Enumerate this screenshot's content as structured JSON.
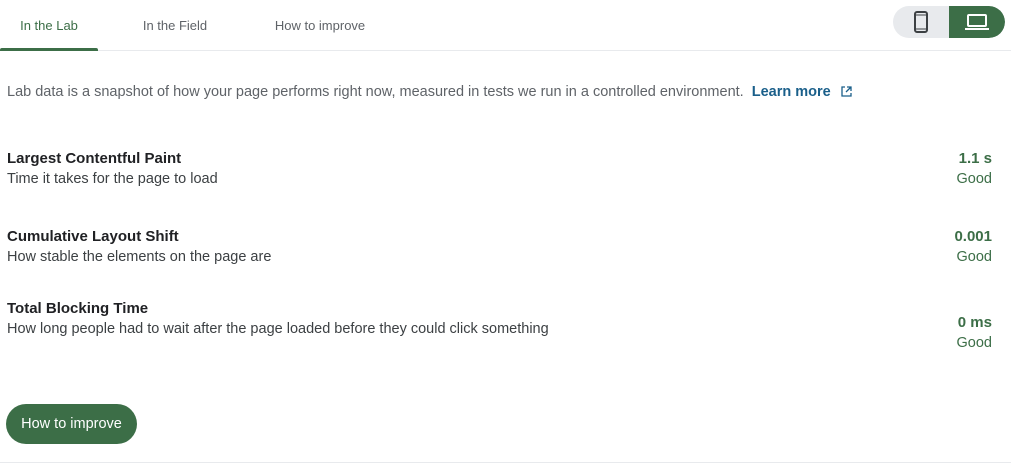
{
  "tabs": [
    {
      "label": "In the Lab",
      "active": true
    },
    {
      "label": "In the Field",
      "active": false
    },
    {
      "label": "How to improve",
      "active": false
    }
  ],
  "device_toggle": {
    "mobile_icon": "smartphone-icon",
    "desktop_icon": "laptop-icon",
    "selected": "desktop"
  },
  "intro": {
    "text": "Lab data is a snapshot of how your page performs right now, measured in tests we run in a controlled environment.",
    "link_label": "Learn more",
    "link_icon": "external-link-icon"
  },
  "metrics": [
    {
      "title": "Largest Contentful Paint",
      "description": "Time it takes for the page to load",
      "value": "1.1 s",
      "rating": "Good"
    },
    {
      "title": "Cumulative Layout Shift",
      "description": "How stable the elements on the page are",
      "value": "0.001",
      "rating": "Good"
    },
    {
      "title": "Total Blocking Time",
      "description": "How long people had to wait after the page loaded before they could click something",
      "value": "0 ms",
      "rating": "Good"
    }
  ],
  "improve_button": {
    "label": "How to improve"
  },
  "colors": {
    "accent": "#3c6e47",
    "link": "#1a5f8a",
    "toggle_bg": "#e8eaed"
  }
}
